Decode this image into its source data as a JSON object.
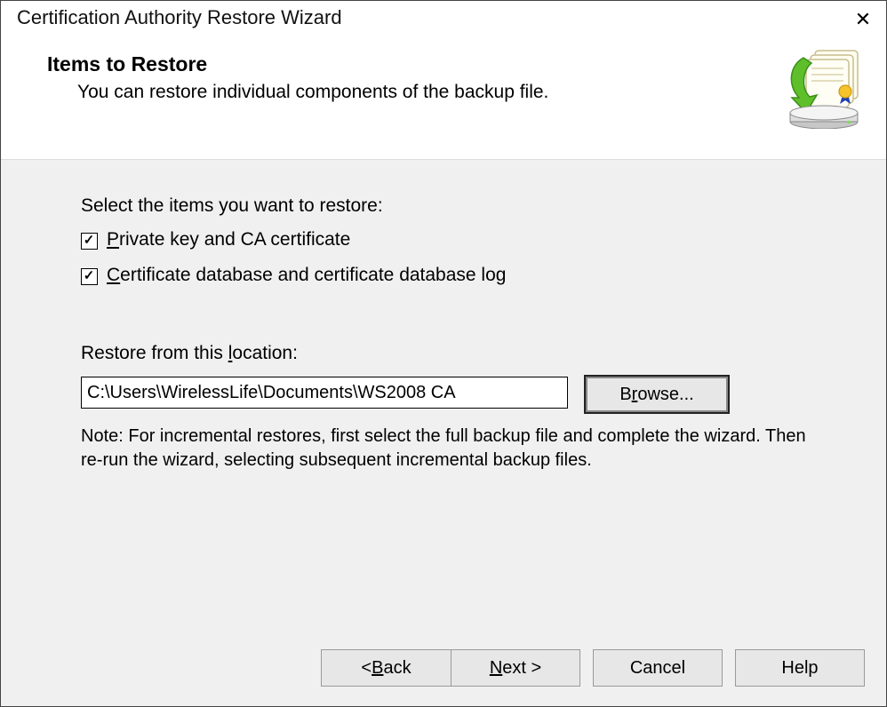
{
  "window": {
    "title": "Certification Authority Restore Wizard"
  },
  "header": {
    "heading": "Items to Restore",
    "sub": "You can restore individual components of the backup file."
  },
  "body": {
    "select_label": "Select the items you want to restore:",
    "chk1_label_pre": "P",
    "chk1_label_rest": "rivate key and CA certificate",
    "chk1_checked": true,
    "chk2_label_pre": "C",
    "chk2_label_rest": "ertificate database and certificate database log",
    "chk2_checked": true,
    "location_label_pre": "Restore from this ",
    "location_label_u": "l",
    "location_label_post": "ocation:",
    "path_value": "C:\\Users\\WirelessLife\\Documents\\WS2008 CA",
    "browse_label_pre": "B",
    "browse_label_u": "r",
    "browse_label_post": "owse...",
    "note": "Note: For incremental restores, first select the full backup file and complete the wizard. Then re-run the wizard, selecting subsequent incremental backup files."
  },
  "footer": {
    "back_pre": "< ",
    "back_u": "B",
    "back_post": "ack",
    "next_u": "N",
    "next_post": "ext >",
    "cancel": "Cancel",
    "help": "Help"
  }
}
